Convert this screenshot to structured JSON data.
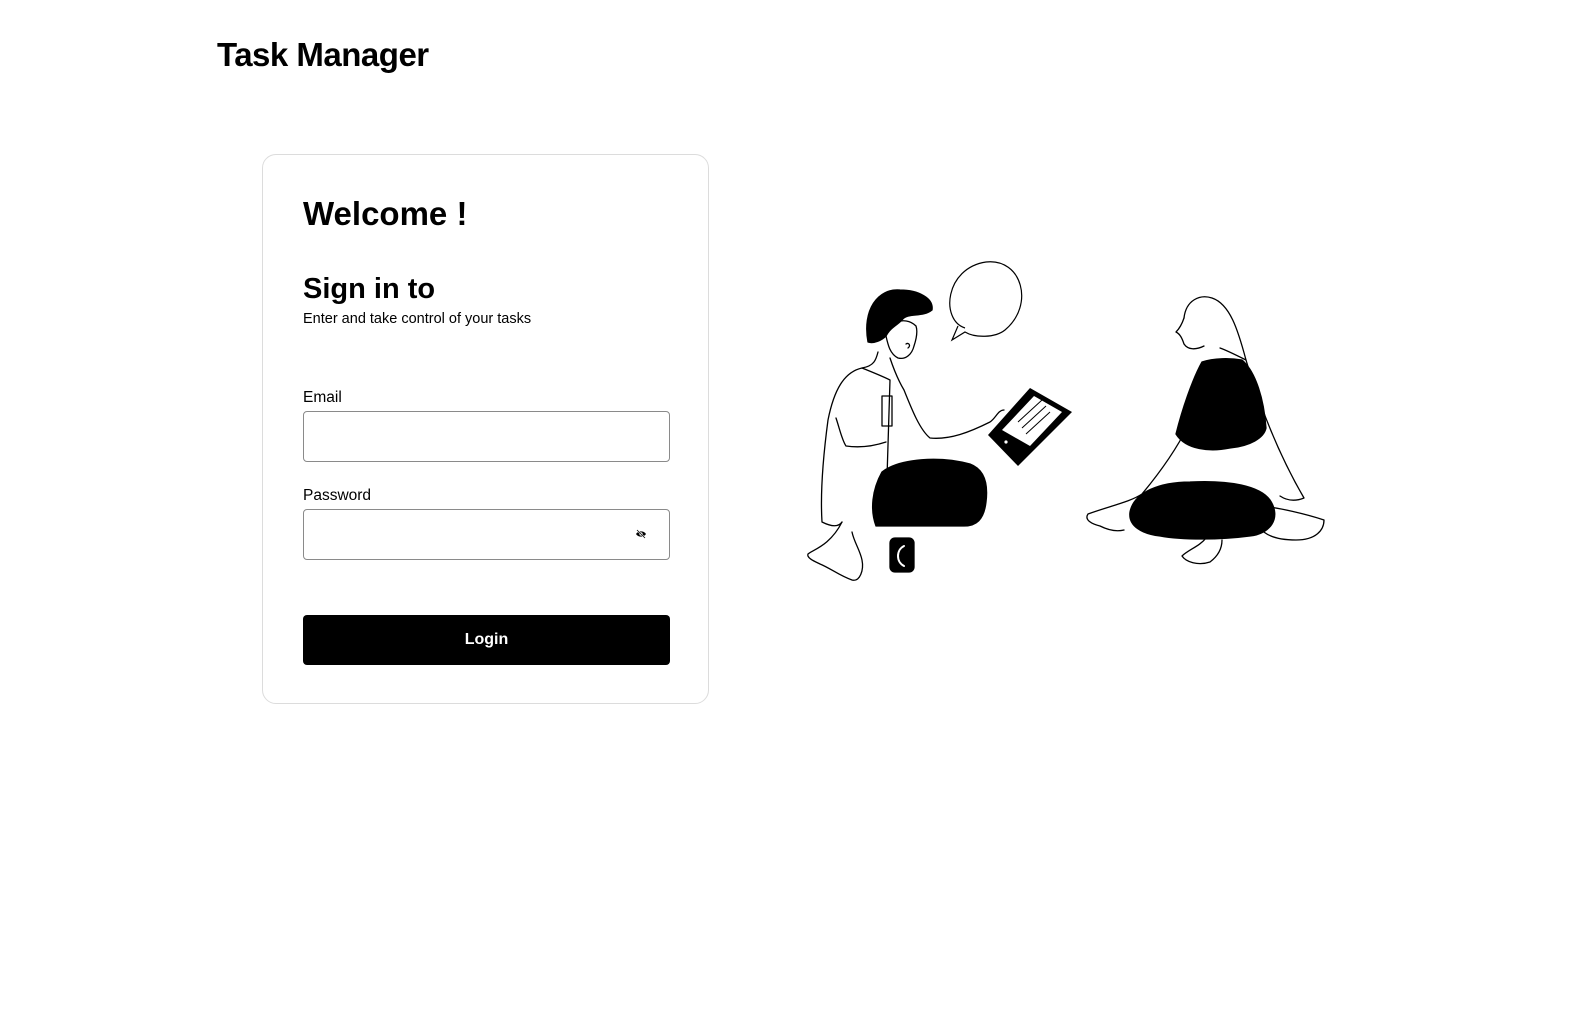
{
  "header": {
    "app_title": "Task Manager"
  },
  "login": {
    "welcome": "Welcome !",
    "signin_title": "Sign in to",
    "signin_subtitle": "Enter and take control of your tasks",
    "email_label": "Email",
    "email_value": "",
    "password_label": "Password",
    "password_value": "",
    "password_toggle_icon": "eye-off-icon",
    "login_button": "Login"
  },
  "illustration": {
    "description_icon": "people-discussing-illustration"
  },
  "colors": {
    "primary": "#000000",
    "background": "#ffffff",
    "card_border": "#dcdcdc",
    "input_border": "#8a8a8a"
  }
}
